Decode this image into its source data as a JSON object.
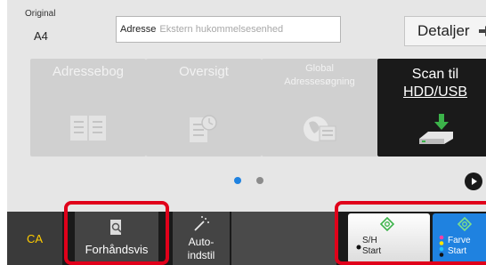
{
  "original": {
    "label": "Original",
    "value": "A4"
  },
  "address": {
    "label": "Adresse",
    "placeholder": "Ekstern hukommelsesenhed"
  },
  "details_button": {
    "label": "Detaljer"
  },
  "tiles": [
    {
      "label": "Adressebog",
      "icon": "address-book-icon",
      "active": false
    },
    {
      "label": "Oversigt",
      "icon": "history-icon",
      "active": false
    },
    {
      "label_line1": "Global",
      "label_line2": "Adressesøgning",
      "icon": "global-address-icon",
      "active": false
    },
    {
      "label_line1": "Scan til",
      "label_line2": "HDD/USB",
      "icon": "usb-drive-icon",
      "active": true
    }
  ],
  "pager": {
    "pages": 2,
    "current": 1
  },
  "bottom": {
    "ca_label": "CA",
    "preview_label": "Forhåndsvis",
    "auto_line1": "Auto-",
    "auto_line2": "indstil",
    "bw_line1": "S/H",
    "bw_line2": "Start",
    "color_line1": "Farve",
    "color_line2": "Start"
  },
  "colors": {
    "accent_blue": "#1f82e0",
    "highlight_red": "#e0001a",
    "ca_yellow": "#ffcc00",
    "start_green": "#3cb34a"
  }
}
